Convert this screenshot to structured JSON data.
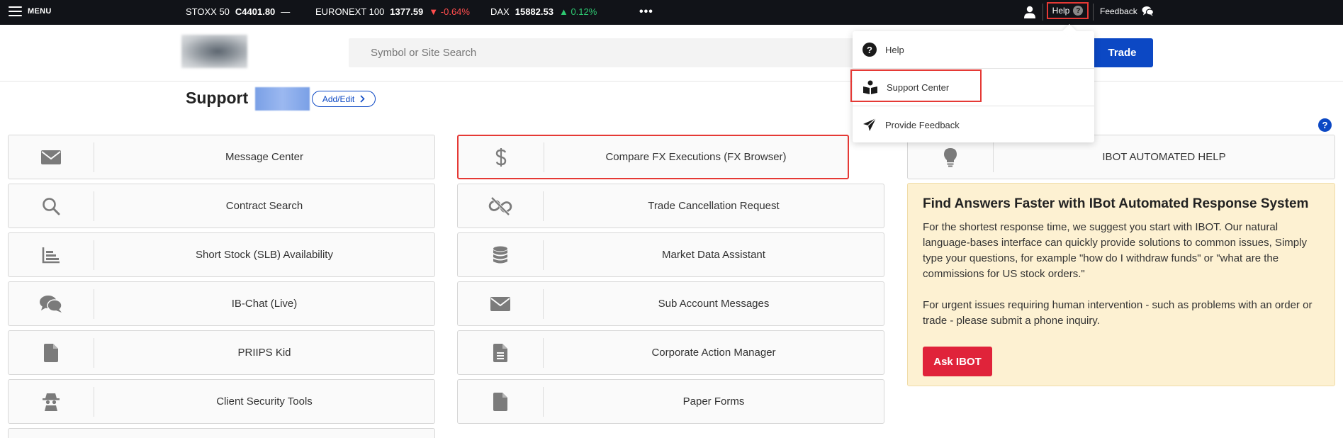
{
  "topbar": {
    "menu_label": "MENU",
    "tickers": [
      {
        "name": "STOXX 50",
        "value": "C4401.80",
        "change": "—",
        "direction": "flat"
      },
      {
        "name": "EURONEXT 100",
        "value": "1377.59",
        "change": "▼ -0.64%",
        "direction": "down"
      },
      {
        "name": "DAX",
        "value": "15882.53",
        "change": "▲ 0.12%",
        "direction": "up"
      }
    ],
    "more_label": "•••",
    "help_label": "Help",
    "help_glyph": "?",
    "feedback_label": "Feedback"
  },
  "header": {
    "search_placeholder": "Symbol or Site Search",
    "trade_label": "Trade"
  },
  "page": {
    "title": "Support",
    "add_edit_label": "Add/Edit",
    "help_glyph": "?"
  },
  "tiles_col1": [
    {
      "label": "Message Center",
      "icon": "envelope-icon"
    },
    {
      "label": "Contract Search",
      "icon": "search-icon"
    },
    {
      "label": "Short Stock (SLB) Availability",
      "icon": "bar-chart-icon"
    },
    {
      "label": "IB-Chat (Live)",
      "icon": "chat-icon"
    },
    {
      "label": "PRIIPS Kid",
      "icon": "document-icon"
    },
    {
      "label": "Client Security Tools",
      "icon": "spy-icon"
    }
  ],
  "tiles_col2": [
    {
      "label": "Compare FX Executions (FX Browser)",
      "icon": "dollar-icon",
      "highlighted": true
    },
    {
      "label": "Trade Cancellation Request",
      "icon": "broken-link-icon"
    },
    {
      "label": "Market Data Assistant",
      "icon": "database-icon"
    },
    {
      "label": "Sub Account Messages",
      "icon": "envelope-icon"
    },
    {
      "label": "Corporate Action Manager",
      "icon": "file-text-icon"
    },
    {
      "label": "Paper Forms",
      "icon": "document-icon"
    }
  ],
  "tiles_col3": [
    {
      "label": "IBOT AUTOMATED HELP",
      "icon": "lightbulb-icon"
    }
  ],
  "ibot": {
    "title": "Find Answers Faster with IBot Automated Response System",
    "paragraph1": "For the shortest response time, we suggest you start with IBOT. Our natural language-bases interface can quickly provide solutions to common issues, Simply type your questions, for example \"how do I withdraw funds\" or \"what are the commissions for US stock orders.\"",
    "paragraph2": "For urgent issues requiring human intervention - such as problems with an order or trade - please submit a phone inquiry.",
    "button_label": "Ask IBOT"
  },
  "dropdown": {
    "items": [
      {
        "label": "Help",
        "icon": "question-circle-icon",
        "glyph": "?"
      },
      {
        "label": "Support Center",
        "icon": "support-center-icon",
        "highlighted": true
      },
      {
        "label": "Provide Feedback",
        "icon": "paper-plane-icon"
      }
    ]
  },
  "colors": {
    "topbar_bg": "#111318",
    "accent_blue": "#0c48c4",
    "highlight_red": "#e53935",
    "ibot_bg": "#fdf1d2",
    "ask_button": "#e0233a",
    "ticker_down": "#ff4d4d",
    "ticker_up": "#2ec971"
  }
}
